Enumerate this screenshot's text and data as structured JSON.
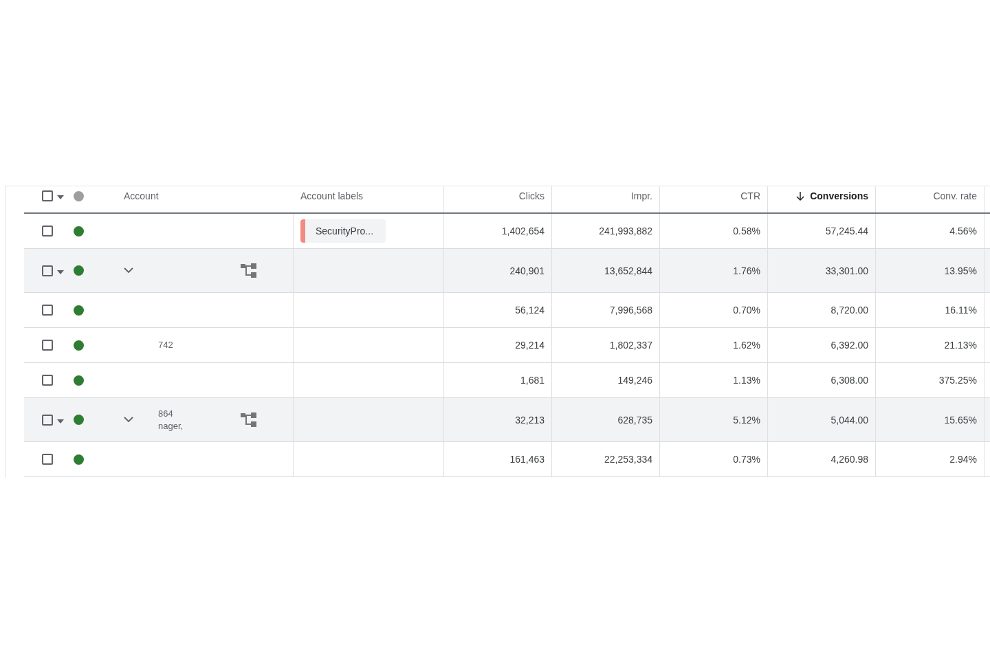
{
  "table": {
    "header_checkbox": {
      "checked": false
    },
    "columns": [
      {
        "label": "Account",
        "kind": "text",
        "sorted": false
      },
      {
        "label": "Account labels",
        "kind": "text",
        "sorted": false
      },
      {
        "label": "Clicks",
        "kind": "number",
        "sorted": false
      },
      {
        "label": "Impr.",
        "kind": "number",
        "sorted": false
      },
      {
        "label": "CTR",
        "kind": "number",
        "sorted": false
      },
      {
        "label": "Conversions",
        "kind": "number",
        "sorted": true
      },
      {
        "label": "Conv. rate",
        "kind": "number",
        "sorted": false
      }
    ],
    "rows": [
      {
        "kind": "account",
        "checked": false,
        "account": [],
        "label": {
          "text": "SecurityPro...",
          "color": "#f28b82"
        },
        "values": [
          "1,402,654",
          "241,993,882",
          "0.58%",
          "57,245.44",
          "4.56%"
        ]
      },
      {
        "kind": "manager",
        "checked": false,
        "expanded": false,
        "account": [],
        "values": [
          "240,901",
          "13,652,844",
          "1.76%",
          "33,301.00",
          "13.95%"
        ]
      },
      {
        "kind": "account",
        "checked": false,
        "account": [],
        "values": [
          "56,124",
          "7,996,568",
          "0.70%",
          "8,720.00",
          "16.11%"
        ]
      },
      {
        "kind": "account",
        "checked": false,
        "account": [
          "742"
        ],
        "values": [
          "29,214",
          "1,802,337",
          "1.62%",
          "6,392.00",
          "21.13%"
        ]
      },
      {
        "kind": "account",
        "checked": false,
        "account": [],
        "values": [
          "1,681",
          "149,246",
          "1.13%",
          "6,308.00",
          "375.25%"
        ]
      },
      {
        "kind": "manager",
        "checked": false,
        "expanded": false,
        "account": [
          "864",
          "nager,"
        ],
        "values": [
          "32,213",
          "628,735",
          "5.12%",
          "5,044.00",
          "15.65%"
        ]
      },
      {
        "kind": "account",
        "checked": false,
        "account": [],
        "values": [
          "161,463",
          "22,253,334",
          "0.73%",
          "4,260.98",
          "2.94%"
        ]
      }
    ]
  }
}
